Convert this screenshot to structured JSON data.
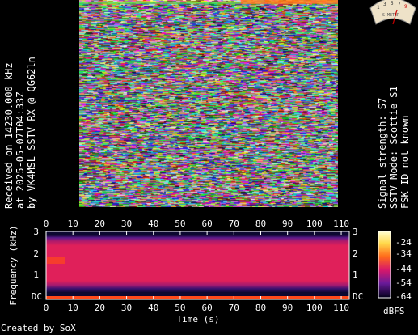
{
  "left_caption": {
    "line1": "Received on  14230.000 kHz",
    "line2": "at 2025-05-07T04:33Z",
    "line3": "by VK4MSL SSTV RX @ QG62ln"
  },
  "right_caption": {
    "line1": "Signal strength: S7",
    "line2": "SSTV Mode: Scottie S1",
    "line3": "FSK ID not known"
  },
  "s_meter": {
    "scale": [
      "1",
      "3",
      "5",
      "7",
      "9"
    ],
    "label": "S-METER",
    "reading": 7
  },
  "spectrogram": {
    "time_ticks": [
      "0",
      "10",
      "20",
      "30",
      "40",
      "50",
      "60",
      "70",
      "80",
      "90",
      "100",
      "110"
    ],
    "freq_ticks_left": [
      "3",
      "2",
      "1",
      "DC"
    ],
    "freq_ticks_right": [
      "3",
      "2",
      "1",
      "DC"
    ],
    "xlabel": "Time (s)",
    "ylabel": "Frequency (kHz)",
    "colorbar_ticks": [
      "-24",
      "-34",
      "-44",
      "-54",
      "-64"
    ],
    "colorbar_unit": "dBFS",
    "colors": {
      "band": "#e0205a",
      "band_edge": "#7a1e9a",
      "floor": "#20105a",
      "dc_line": "#ff4a1a"
    }
  },
  "footer": {
    "credit": "Created by SoX"
  }
}
